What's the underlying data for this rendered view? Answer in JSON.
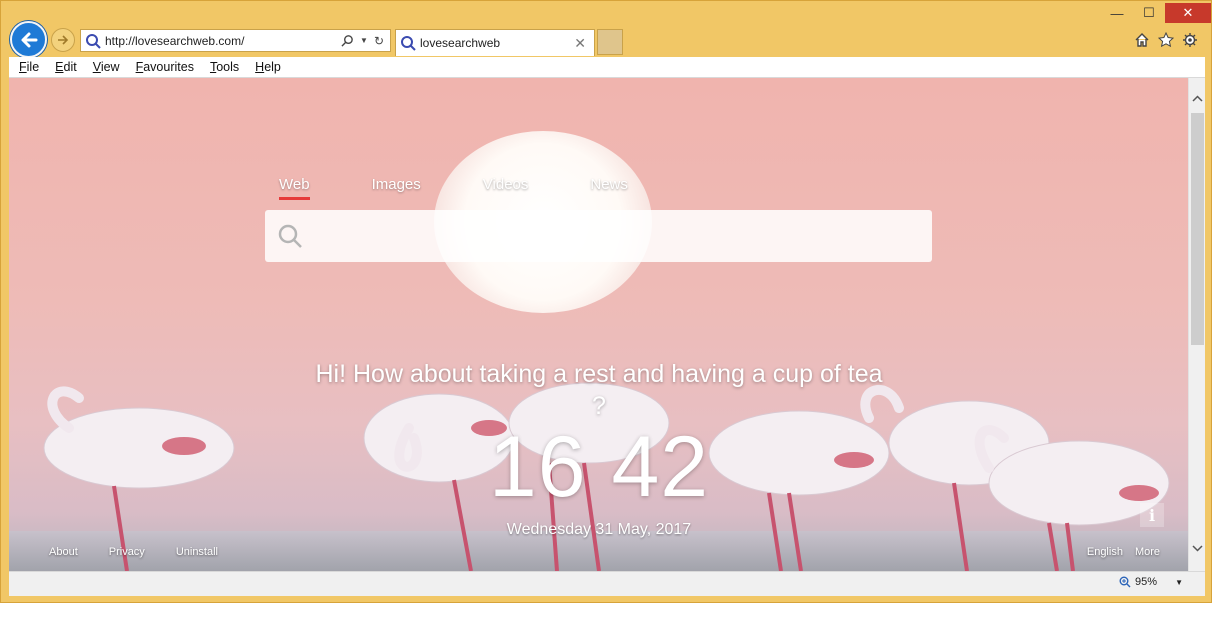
{
  "browser": {
    "address_url": "http://lovesearchweb.com/",
    "tab_title": "lovesearchweb",
    "menu": [
      "File",
      "Edit",
      "View",
      "Favourites",
      "Tools",
      "Help"
    ],
    "zoom": "95%"
  },
  "page": {
    "search_tabs": [
      "Web",
      "Images",
      "Videos",
      "News"
    ],
    "active_tab": "Web",
    "search_placeholder": "",
    "greeting": "Hi! How about taking a rest and having a cup of tea ?",
    "clock": "16 42",
    "date": "Wednesday 31 May, 2017",
    "footer_left": [
      "About",
      "Privacy",
      "Uninstall"
    ],
    "footer_right": [
      "English",
      "More"
    ],
    "info": "i"
  }
}
